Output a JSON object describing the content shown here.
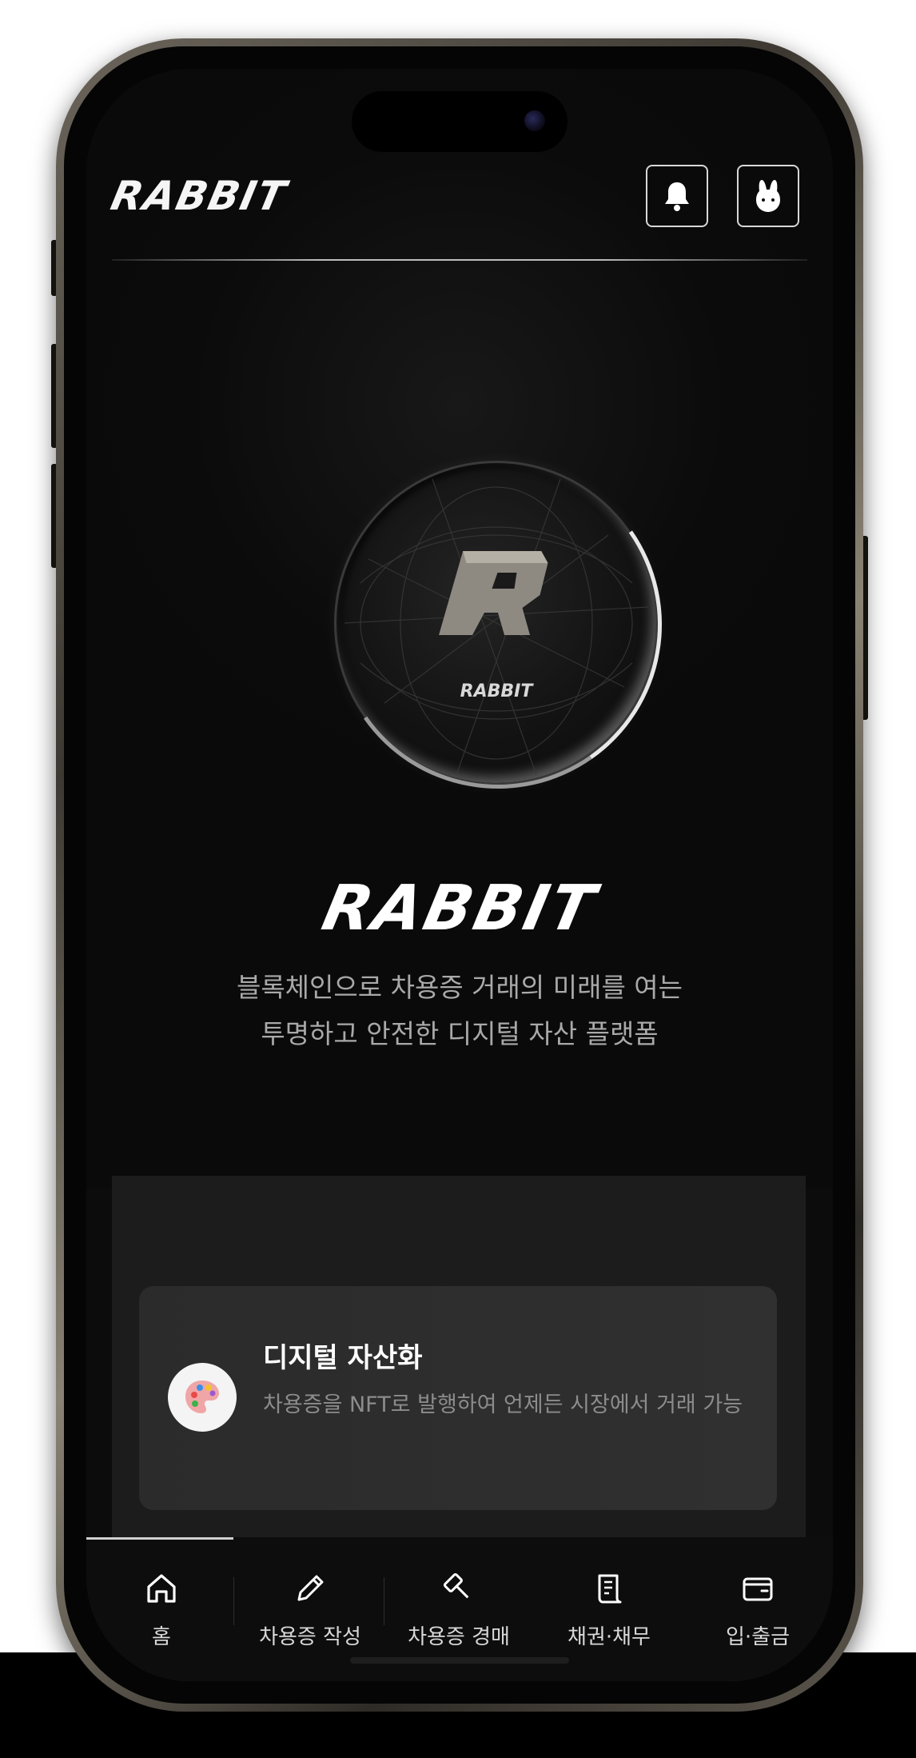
{
  "app": {
    "logo_text": "RABBIT"
  },
  "header": {
    "notifications_icon": "bell-icon",
    "profile_icon": "rabbit-icon"
  },
  "hero": {
    "coin_logo_text": "RABBIT",
    "title": "RABBIT",
    "subtitle_line1": "블록체인으로 차용증 거래의 미래를 여는",
    "subtitle_line2": "투명하고 안전한 디지털 자산 플랫폼"
  },
  "features": [
    {
      "icon": "palette-icon",
      "title": "디지털 자산화",
      "description": "차용증을 NFT로 발행하여 언제든 시장에서 거래 가능"
    }
  ],
  "bottom_nav": {
    "active_index": 0,
    "items": [
      {
        "label": "홈",
        "icon": "home-icon"
      },
      {
        "label": "차용증 작성",
        "icon": "pencil-icon"
      },
      {
        "label": "차용증 경매",
        "icon": "gavel-icon"
      },
      {
        "label": "채권·채무",
        "icon": "scroll-icon"
      },
      {
        "label": "입·출금",
        "icon": "wallet-icon"
      }
    ]
  },
  "colors": {
    "screen_bg": "#0c0c0c",
    "card_bg": "#2b2b2b",
    "text_primary": "#ffffff",
    "text_secondary": "#a9a9a9"
  }
}
